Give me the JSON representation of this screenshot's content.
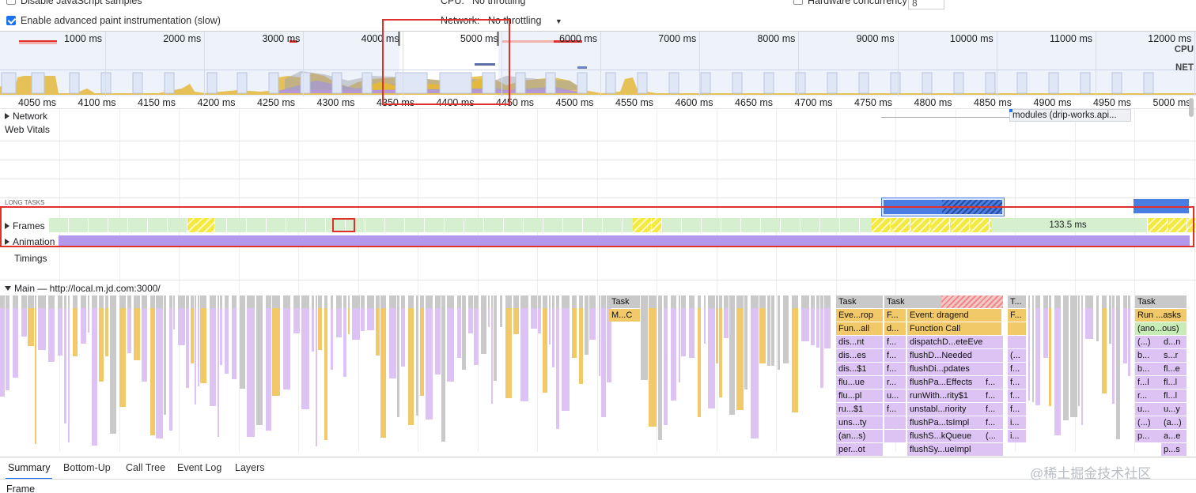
{
  "settings": {
    "disable_js_label": "Disable JavaScript samples",
    "paint_label": "Enable advanced paint instrumentation (slow)",
    "cpu_label": "CPU:",
    "cpu_value": "No throttling",
    "network_label": "Network:",
    "network_value": "No throttling",
    "hw_label": "Hardware concurrency",
    "hw_value": "8"
  },
  "overview": {
    "ticks": [
      "1000 ms",
      "2000 ms",
      "3000 ms",
      "4000 ms",
      "5000 ms",
      "6000 ms",
      "7000 ms",
      "8000 ms",
      "9000 ms",
      "10000 ms",
      "11000 ms",
      "12000 ms"
    ],
    "cpu_label": "CPU",
    "net_label": "NET"
  },
  "ruler": {
    "ticks": [
      "4050 ms",
      "4100 ms",
      "4150 ms",
      "4200 ms",
      "4250 ms",
      "4300 ms",
      "4350 ms",
      "4400 ms",
      "4450 ms",
      "4500 ms",
      "4550 ms",
      "4600 ms",
      "4650 ms",
      "4700 ms",
      "4750 ms",
      "4800 ms",
      "4850 ms",
      "4900 ms",
      "4950 ms",
      "5000 ms"
    ]
  },
  "tracks": {
    "network": "Network",
    "network_item": "modules (drip-works.api...",
    "web_vitals": "Web Vitals",
    "long_tasks": "LONG TASKS",
    "frames": "Frames",
    "frame_duration": "133.5 ms",
    "animation": "Animation",
    "timings": "Timings",
    "main": "Main — http://local.m.jd.com:3000/"
  },
  "flame": {
    "task_mc": "M...C",
    "task": "Task",
    "col_a": [
      "Eve...rop",
      "Fun...all",
      "dis...nt",
      "dis...es",
      "dis...$1",
      "flu...ue",
      "flu...pl",
      "ru...$1",
      "uns...ty",
      "(an...s)",
      "per...ot"
    ],
    "col_b": [
      "F...",
      "d...",
      "f...",
      "f...",
      "f...",
      "r...",
      "u...",
      "f...",
      "",
      ""
    ],
    "col_c": [
      "Event: dragend",
      "Function Call",
      "dispatchD...eteEvent",
      "flushD...Needed",
      "flushDi...pdates",
      "flushPa...Effects",
      "runWith...rity$1",
      "unstabl...riority",
      "flushPa...tsImpl",
      "flushS...kQueue",
      "flushSy...ueImpl"
    ],
    "col_c2": [
      "",
      "",
      "",
      "",
      "",
      "f...",
      "f...",
      "f...",
      "f...",
      "(...",
      ""
    ],
    "col_t": [
      "T...",
      "F...",
      "",
      "",
      "(...",
      "f...",
      "f...",
      "f...",
      "f...",
      "i...",
      "i..."
    ],
    "col_r1": [
      "Run ...asks",
      "(ano...ous)",
      "(...)",
      "b...",
      "b...",
      "f...l",
      "r...",
      "u...",
      "(...)",
      "p..."
    ],
    "col_r2": [
      "",
      "",
      "d...n",
      "s...r",
      "fl...e",
      "fl...l",
      "fl...l",
      "u...y",
      "(a...)",
      "a...e",
      "p...s"
    ]
  },
  "tabs": [
    "Summary",
    "Bottom-Up",
    "Call Tree",
    "Event Log",
    "Layers"
  ],
  "footer": {
    "selected": "Frame",
    "watermark": "@稀土掘金技术社区"
  },
  "colors": {
    "highlight": "#e0302b",
    "task_gray": "#c8c8c8",
    "script_yellow": "#f2c968",
    "purple": "#d9b8f0",
    "frame_green": "#d6f0cf",
    "long_task_blue": "#4a7de3",
    "accent": "#1a73e8"
  }
}
